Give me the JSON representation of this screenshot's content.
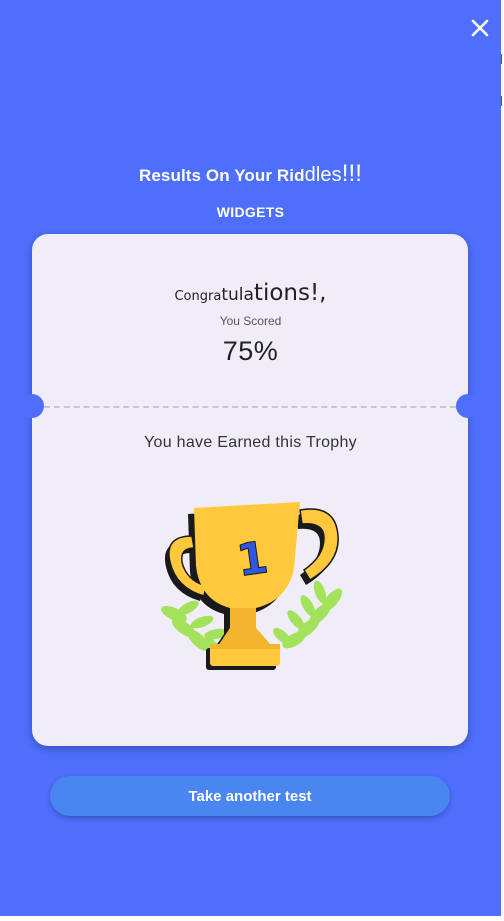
{
  "header": {
    "close_icon": "close-icon",
    "title_main": "Results On Your Rid",
    "title_end": "dles",
    "title_bang": "!!!",
    "subtitle": "WIDGETS"
  },
  "result_card": {
    "congrats_part1": "Congra",
    "congrats_part2": "tula",
    "congrats_part3": "tions!,",
    "scored_label": "You Scored",
    "score": "75%",
    "earned_text": "You have Earned this Trophy",
    "trophy_icon": "trophy-icon",
    "trophy_number": "1"
  },
  "actions": {
    "take_another_label": "Take another test"
  },
  "colors": {
    "background": "#4E6EFC",
    "card": "#F1EDF8",
    "button": "#4A86F0",
    "trophy_gold": "#FFC83D",
    "trophy_number": "#2F58E0",
    "laurel": "#A3E25B"
  }
}
